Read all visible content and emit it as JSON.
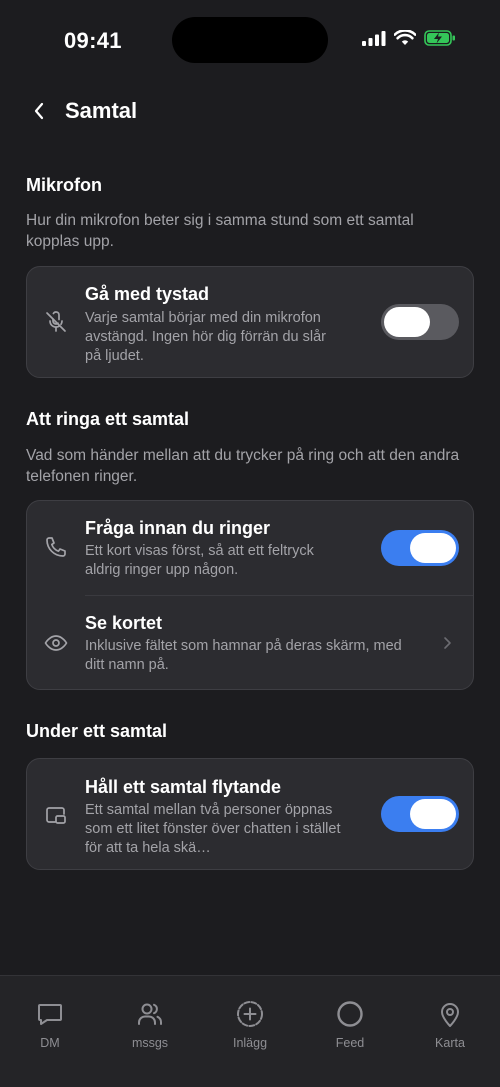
{
  "status": {
    "time": "09:41"
  },
  "header": {
    "title": "Samtal",
    "back_icon": "chevron-left-icon"
  },
  "sections": [
    {
      "title": "Mikrofon",
      "description": "Hur din mikrofon beter sig i samma stund som ett samtal kopplas upp.",
      "rows": [
        {
          "icon": "mic-off-icon",
          "title": "Gå med tystad",
          "subtitle": "Varje samtal börjar med din mikrofon avstängd. Ingen hör dig förrän du slår på ljudet.",
          "control": "toggle",
          "on": false
        }
      ]
    },
    {
      "title": "Att ringa ett samtal",
      "description": "Vad som händer mellan att du trycker på ring och att den andra telefonen ringer.",
      "rows": [
        {
          "icon": "phone-icon",
          "title": "Fråga innan du ringer",
          "subtitle": "Ett kort visas först, så att ett feltryck aldrig ringer upp någon.",
          "control": "toggle",
          "on": true
        },
        {
          "icon": "eye-icon",
          "title": "Se kortet",
          "subtitle": "Inklusive fältet som hamnar på deras skärm, med ditt namn på.",
          "control": "chevron"
        }
      ]
    },
    {
      "title": "Under ett samtal",
      "description": "",
      "rows": [
        {
          "icon": "picture-in-picture-icon",
          "title": "Håll ett samtal flytande",
          "subtitle": "Ett samtal mellan två personer öppnas som ett litet fönster över chatten i stället för att ta hela skä…",
          "control": "toggle",
          "on": true
        }
      ]
    }
  ],
  "tabs": [
    {
      "label": "DM",
      "icon": "chat-bubble-icon"
    },
    {
      "label": "mssgs",
      "icon": "people-icon"
    },
    {
      "label": "Inlägg",
      "icon": "plus-circle-icon"
    },
    {
      "label": "Feed",
      "icon": "circle-icon"
    },
    {
      "label": "Karta",
      "icon": "map-pin-icon"
    }
  ],
  "colors": {
    "background": "#1c1c1f",
    "card": "#2c2c30",
    "accent": "#3b7ef0",
    "battery": "#34c759"
  }
}
